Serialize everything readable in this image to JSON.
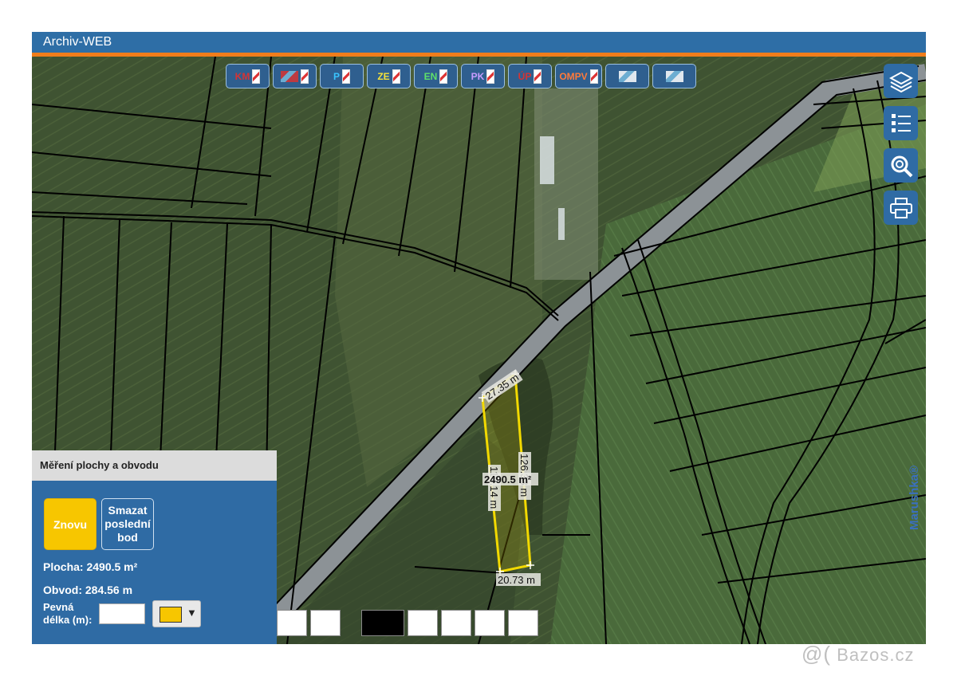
{
  "window": {
    "title": "Archiv-WEB"
  },
  "toolbar": {
    "buttons": [
      {
        "label": "KM",
        "icon": "cadastral-map-icon",
        "color": "#d63333"
      },
      {
        "label": "",
        "icon": "points-icon",
        "color": "#d63333"
      },
      {
        "label": "P",
        "icon": "parcel-icon",
        "color": "#39c4ff"
      },
      {
        "label": "ZE",
        "icon": "ze-icon",
        "color": "#f5e23a"
      },
      {
        "label": "EN",
        "icon": "en-icon",
        "color": "#5fe06a"
      },
      {
        "label": "PK",
        "icon": "pk-icon",
        "color": "#c79cff"
      },
      {
        "label": "ÚP",
        "icon": "up-icon",
        "color": "#d63333"
      },
      {
        "label": "OMPV",
        "icon": "ompv-icon",
        "color": "#ff7a3a"
      },
      {
        "label": "",
        "icon": "orthophoto-icon",
        "color": "#ffffff"
      },
      {
        "label": "",
        "icon": "hybrid-map-icon",
        "color": "#ffffff"
      }
    ]
  },
  "right_tools": [
    "layers-icon",
    "legend-list-icon",
    "zoom-search-icon",
    "print-icon"
  ],
  "measurement": {
    "side_top": "27.35 m",
    "side_right": "126.33 m",
    "side_left": "110.14 m",
    "side_bottom": "20.73 m",
    "area_label": "2490.5 m²"
  },
  "panel": {
    "title": "Měření plochy a obvodu",
    "btn_again": "Znovu",
    "btn_delete_line1": "Smazat",
    "btn_delete_line2": "poslední",
    "btn_delete_line3": "bod",
    "area": "Plocha: 2490.5 m²",
    "perimeter": "Obvod: 284.56 m",
    "fixed_length_line1": "Pevná",
    "fixed_length_line2": "délka (m):",
    "fixed_length_value": "",
    "selected_color": "#f7c600",
    "color_arrow": "▼"
  },
  "line_colors": [
    "#ffffff",
    "#ffffff",
    "#000000",
    "#ffffff",
    "#ffffff",
    "#ffffff",
    "#ffffff"
  ],
  "brand": "Marushka®",
  "watermark": "Bazos.cz",
  "watermark_at": "@("
}
